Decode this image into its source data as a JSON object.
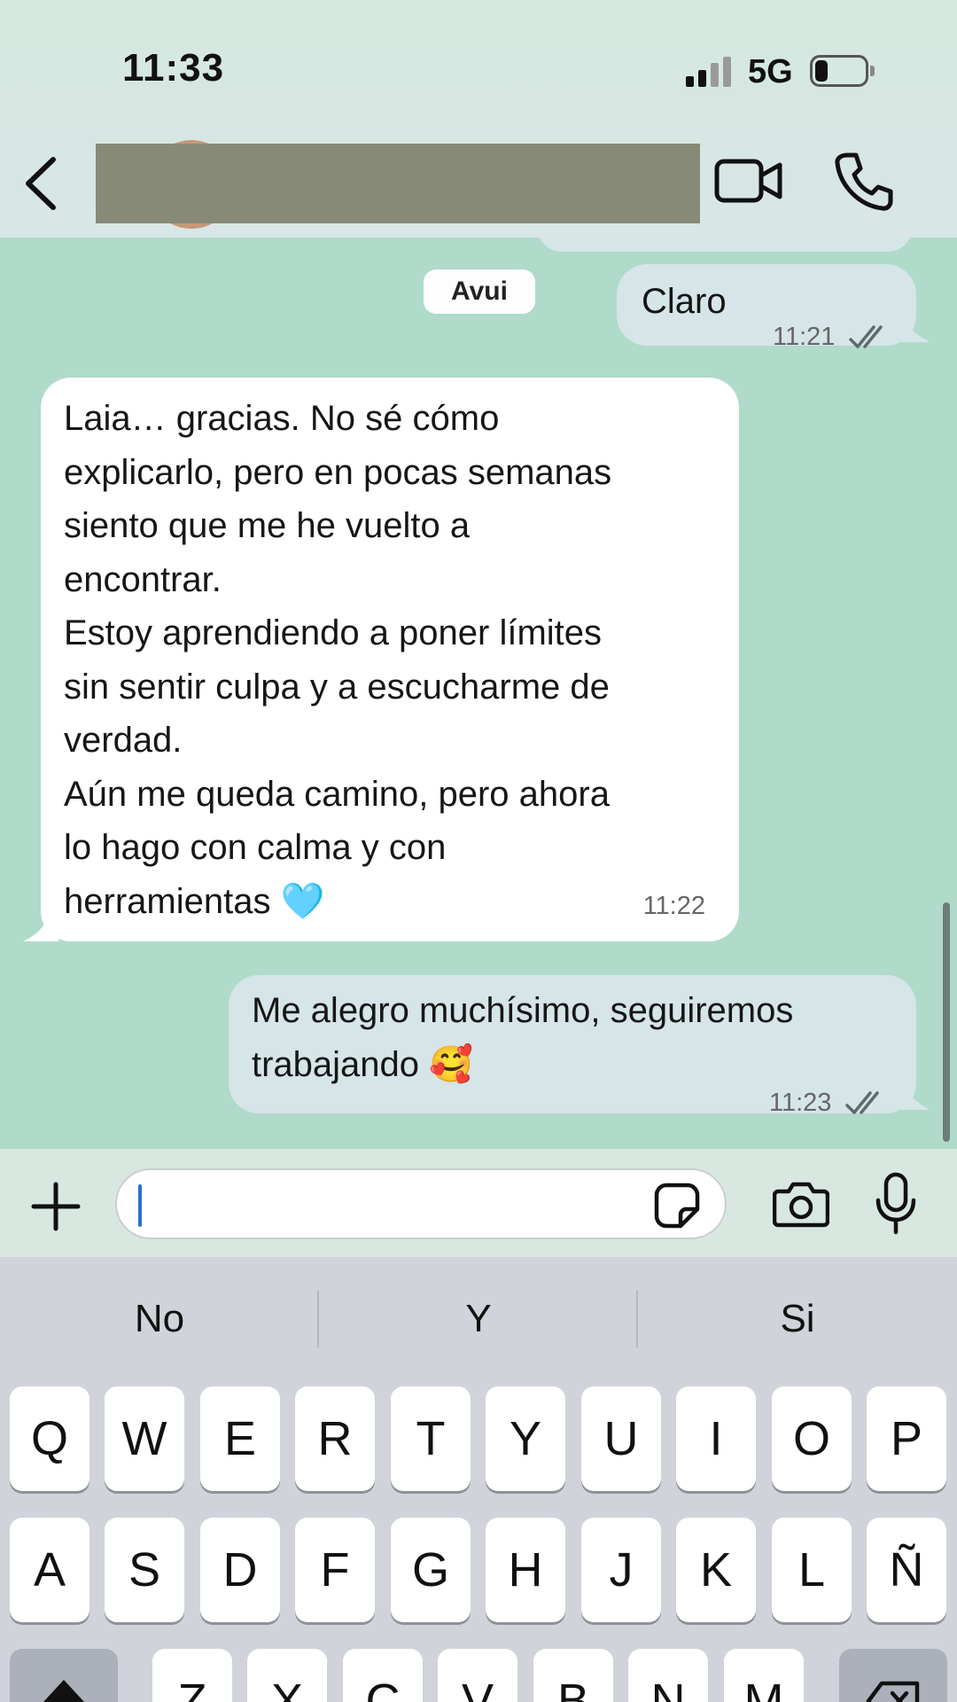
{
  "status_bar": {
    "time": "11:33",
    "network": "5G",
    "signal_bars": 2,
    "signal_bars_total": 4,
    "battery_level": 0.2,
    "icons": [
      "cellular-signal-icon",
      "battery-icon"
    ]
  },
  "header": {
    "contact_name": "",
    "contact_name_redacted": true,
    "icons": [
      "chevron-left-icon",
      "video-camera-icon",
      "phone-icon"
    ]
  },
  "chat": {
    "date_separator": "Avui",
    "messages": [
      {
        "direction": "outgoing",
        "text": "Claro",
        "time": "11:21",
        "status": "read"
      },
      {
        "direction": "incoming",
        "text": "Laia… gracias. No sé cómo\nexplicarlo, pero en pocas semanas\nsiento que me he vuelto a\nencontrar.\nEstoy aprendiendo a poner límites\nsin sentir culpa y a escucharme de\nverdad.\nAún me queda camino, pero ahora\nlo hago con calma y con\nherramientas 🩵",
        "time": "11:22"
      },
      {
        "direction": "outgoing",
        "text": "Me alegro muchísimo, seguiremos\ntrabajando 🥰",
        "time": "11:23",
        "status": "read"
      }
    ]
  },
  "composer": {
    "input_value": "",
    "icons": [
      "plus-icon",
      "sticker-icon",
      "camera-icon",
      "microphone-icon"
    ]
  },
  "keyboard": {
    "suggestions": [
      "No",
      "Y",
      "Si"
    ],
    "row1": [
      "Q",
      "W",
      "E",
      "R",
      "T",
      "Y",
      "U",
      "I",
      "O",
      "P"
    ],
    "row2": [
      "A",
      "S",
      "D",
      "F",
      "G",
      "H",
      "J",
      "K",
      "L",
      "Ñ"
    ],
    "row3": [
      "Z",
      "X",
      "C",
      "V",
      "B",
      "N",
      "M"
    ],
    "special_keys": [
      "shift-icon",
      "backspace-icon"
    ]
  },
  "colors": {
    "chat_background": "#b0dac9",
    "outgoing_bubble": "#d5e5e8",
    "incoming_bubble": "#ffffff",
    "keyboard_background": "#d0d3d9",
    "cursor": "#2f6fd6"
  }
}
